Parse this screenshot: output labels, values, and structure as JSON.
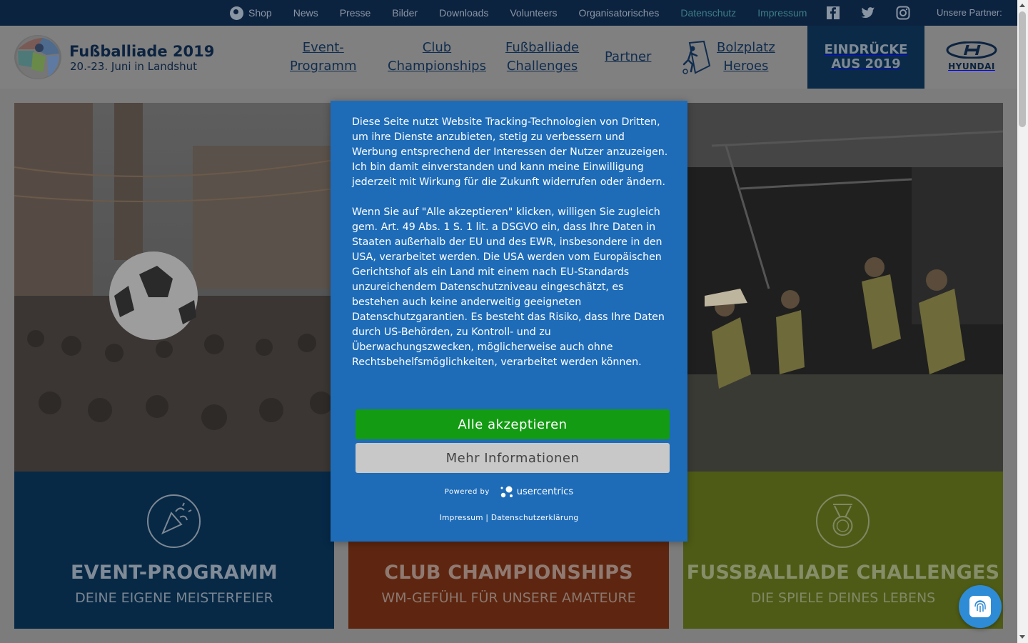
{
  "topbar": {
    "links": [
      "Shop",
      "News",
      "Presse",
      "Bilder",
      "Downloads",
      "Volunteers",
      "Organisatorisches",
      "Datenschutz",
      "Impressum"
    ],
    "social_icons": [
      "facebook-icon",
      "twitter-icon",
      "instagram-icon"
    ],
    "partner_label": "Unsere Partner:"
  },
  "header": {
    "logo_title": "Fußballiade 2019",
    "logo_subtitle": "20.-23. Juni in Landshut",
    "nav": [
      {
        "line1": "Event-",
        "line2": "Programm"
      },
      {
        "line1": "Club",
        "line2": "Championships"
      },
      {
        "line1": "Fußballiade",
        "line2": "Challenges"
      },
      {
        "line1": "Partner",
        "line2": ""
      },
      {
        "line1": "Bolzplatz",
        "line2": "Heroes"
      }
    ],
    "cta_line1": "EINDRÜCKE",
    "cta_line2": "AUS 2019",
    "sponsor": "HYUNDAI"
  },
  "cards": [
    {
      "title": "EVENT-PROGRAMM",
      "subtitle": "DEINE EIGENE MEISTERFEIER",
      "icon": "party-popper-icon"
    },
    {
      "title": "CLUB CHAMPIONSHIPS",
      "subtitle": "WM-GEFÜHL FÜR UNSERE AMATEURE",
      "icon": "trophy-icon"
    },
    {
      "title": "FUSSBALLIADE CHALLENGES",
      "subtitle": "DIE SPIELE DEINES LEBENS",
      "icon": "medal-icon"
    }
  ],
  "consent": {
    "paragraph1": "Diese Seite nutzt Website Tracking-Technologien von Dritten, um ihre Dienste anzubieten, stetig zu verbessern und Werbung entsprechend der Interessen der Nutzer anzuzeigen. Ich bin damit einverstanden und kann meine Einwilligung jederzeit mit Wirkung für die Zukunft widerrufen oder ändern.",
    "paragraph2": "Wenn Sie auf \"Alle akzeptieren\" klicken, willigen Sie zugleich gem. Art. 49 Abs. 1 S. 1 lit. a DSGVO ein, dass Ihre Daten in Staaten außerhalb der EU und des EWR, insbesondere in den USA, verarbeitet werden. Die USA werden vom Europäischen Gerichtshof als ein Land mit einem nach EU-Standards unzureichendem Datenschutzniveau eingeschätzt, es bestehen auch keine anderweitig geeigneten Datenschutzgarantien. Es besteht das Risiko, dass Ihre Daten durch US-Behörden, zu Kontroll- und zu Überwachungszwecken, möglicherweise auch ohne Rechtsbehelfsmöglichkeiten, verarbeitet werden können.",
    "accept_label": "Alle akzeptieren",
    "more_label": "Mehr Informationen",
    "powered_by": "Powered by",
    "provider": "usercentrics",
    "imprint_link": "Impressum",
    "separator": "|",
    "privacy_link": "Datenschutzerklärung"
  },
  "colors": {
    "modal_bg": "#1e6cb8",
    "accept_button": "#139b13",
    "more_button": "#c8c8c8",
    "topbar_bg": "#0c2340"
  }
}
